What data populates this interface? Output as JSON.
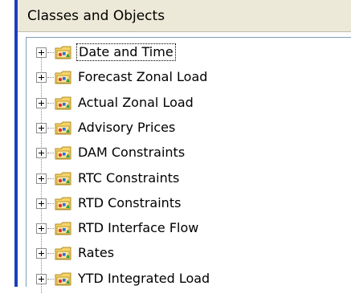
{
  "header": {
    "title": "Classes and Objects"
  },
  "tree": {
    "items": [
      {
        "label": "Date and Time",
        "icon": "folder-objects-icon",
        "expanded": false,
        "focused": true
      },
      {
        "label": "Forecast Zonal Load",
        "icon": "folder-objects-icon",
        "expanded": false,
        "focused": false
      },
      {
        "label": "Actual Zonal Load",
        "icon": "folder-objects-icon",
        "expanded": false,
        "focused": false
      },
      {
        "label": "Advisory Prices",
        "icon": "folder-objects-icon",
        "expanded": false,
        "focused": false
      },
      {
        "label": "DAM Constraints",
        "icon": "folder-objects-icon",
        "expanded": false,
        "focused": false
      },
      {
        "label": "RTC Constraints",
        "icon": "folder-objects-icon",
        "expanded": false,
        "focused": false
      },
      {
        "label": "RTD Constraints",
        "icon": "folder-objects-icon",
        "expanded": false,
        "focused": false
      },
      {
        "label": "RTD Interface Flow",
        "icon": "folder-objects-icon",
        "expanded": false,
        "focused": false
      },
      {
        "label": "Rates",
        "icon": "folder-objects-icon",
        "expanded": false,
        "focused": false
      },
      {
        "label": "YTD Integrated Load",
        "icon": "folder-objects-icon",
        "expanded": false,
        "focused": false
      }
    ]
  },
  "colors": {
    "accent": "#1a3fbf",
    "header_bg": "#ece9d8",
    "folder_yellow": "#f6d46a",
    "folder_outline": "#b08a20"
  }
}
